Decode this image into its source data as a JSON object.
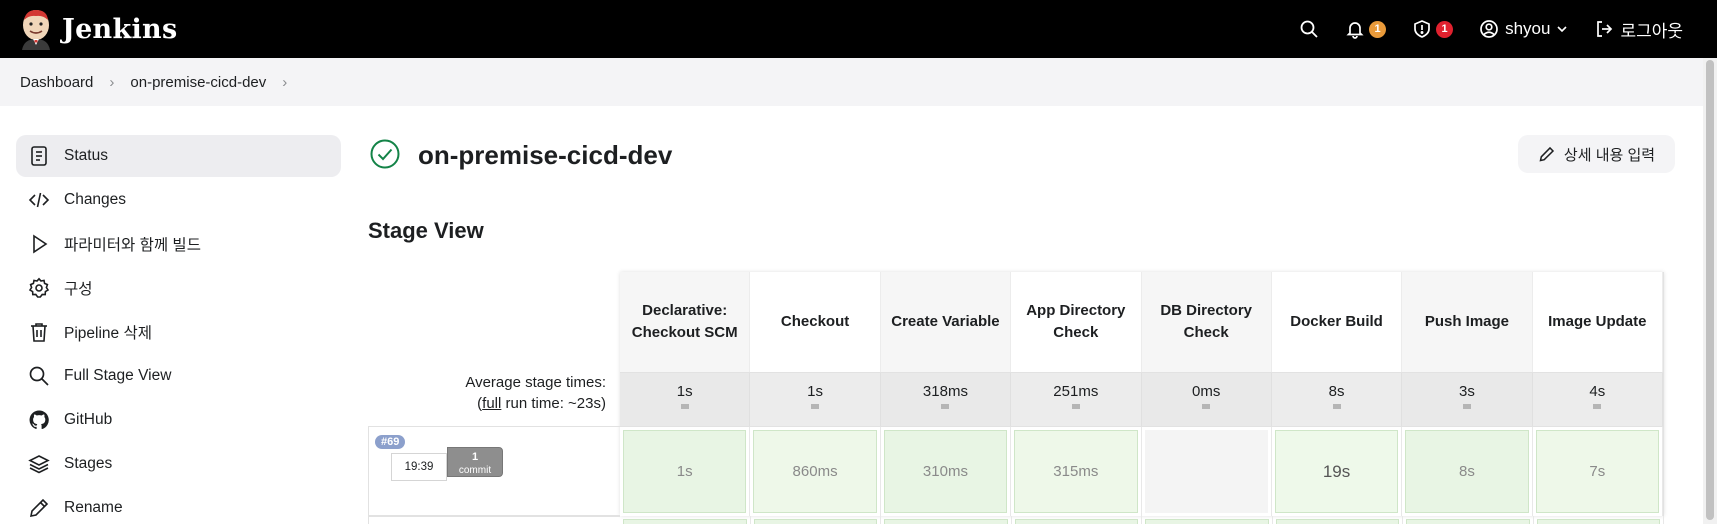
{
  "header": {
    "brand": "Jenkins",
    "notifications_count": "1",
    "security_count": "1",
    "user": "shyou",
    "logout": "로그아웃"
  },
  "breadcrumb": {
    "items": [
      "Dashboard",
      "on-premise-cicd-dev"
    ]
  },
  "sidebar": {
    "items": [
      {
        "label": "Status",
        "icon": "document-icon"
      },
      {
        "label": "Changes",
        "icon": "code-icon"
      },
      {
        "label": "파라미터와 함께 빌드",
        "icon": "play-icon"
      },
      {
        "label": "구성",
        "icon": "gear-icon"
      },
      {
        "label": "Pipeline 삭제",
        "icon": "trash-icon"
      },
      {
        "label": "Full Stage View",
        "icon": "search-icon"
      },
      {
        "label": "GitHub",
        "icon": "github-icon"
      },
      {
        "label": "Stages",
        "icon": "layers-icon"
      },
      {
        "label": "Rename",
        "icon": "pencil-icon"
      }
    ]
  },
  "main": {
    "title": "on-premise-cicd-dev",
    "edit_button": "상세 내용 입력",
    "section_title": "Stage View"
  },
  "stage_view": {
    "avg_label_line1": "Average stage times:",
    "avg_label_line2_prefix": "(",
    "avg_label_full": "full",
    "avg_label_line2_suffix": " run time: ~23s)",
    "stages": [
      "Declarative: Checkout SCM",
      "Checkout",
      "Create Variable",
      "App Directory Check",
      "DB Directory Check",
      "Docker Build",
      "Push Image",
      "Image Update"
    ],
    "averages": [
      "1s",
      "1s",
      "318ms",
      "251ms",
      "0ms",
      "8s",
      "3s",
      "4s"
    ],
    "runs": [
      {
        "build": "#69",
        "time": "19:39",
        "commits": "1",
        "commits_label": "commit",
        "durations": [
          "1s",
          "860ms",
          "310ms",
          "315ms",
          "",
          "19s",
          "8s",
          "7s"
        ]
      }
    ]
  },
  "colors": {
    "header_bg": "#000000",
    "success_green": "#138347",
    "stage_success": "#e8f5e4"
  }
}
